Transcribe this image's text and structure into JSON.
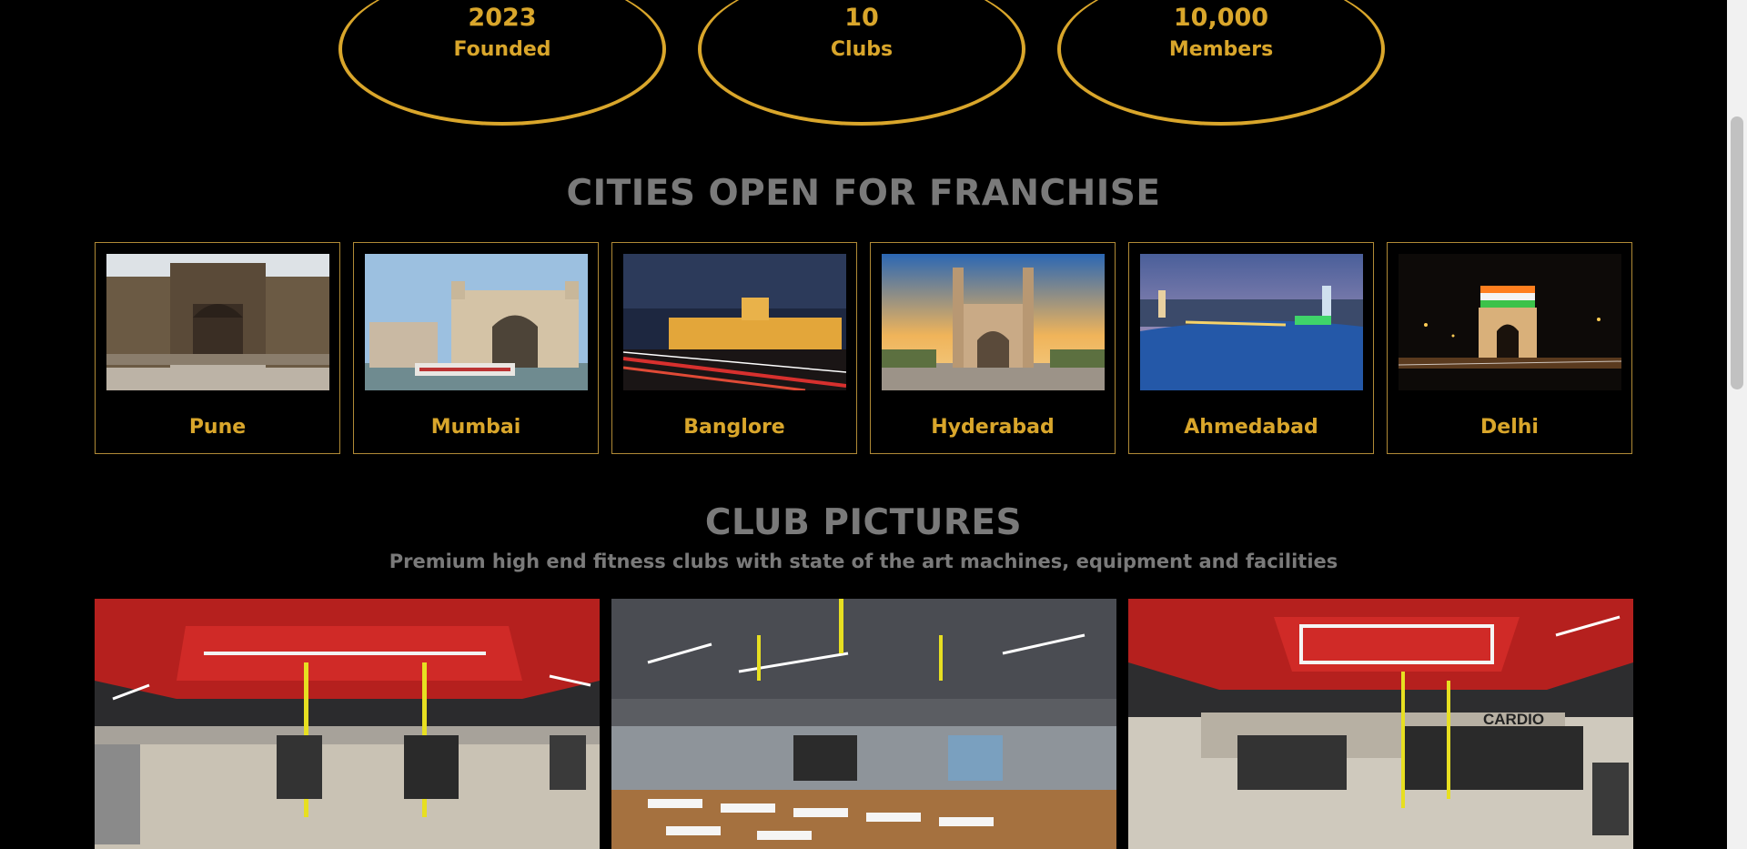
{
  "stats": [
    {
      "value": "2023",
      "label": "Founded"
    },
    {
      "value": "10",
      "label": "Clubs"
    },
    {
      "value": "10,000",
      "label": "Members"
    }
  ],
  "franchise": {
    "title": "CITIES OPEN FOR FRANCHISE",
    "cities": [
      {
        "name": "Pune"
      },
      {
        "name": "Mumbai"
      },
      {
        "name": "Banglore"
      },
      {
        "name": "Hyderabad"
      },
      {
        "name": "Ahmedabad"
      },
      {
        "name": "Delhi"
      }
    ]
  },
  "club_pictures": {
    "title": "CLUB PICTURES",
    "subtitle": "Premium high end fitness clubs with state of the art machines, equipment and facilities",
    "signage_text": "CARDIO"
  },
  "colors": {
    "background": "#000000",
    "accent_gold": "#d9a62b",
    "heading_gray": "#7a7a7a"
  }
}
